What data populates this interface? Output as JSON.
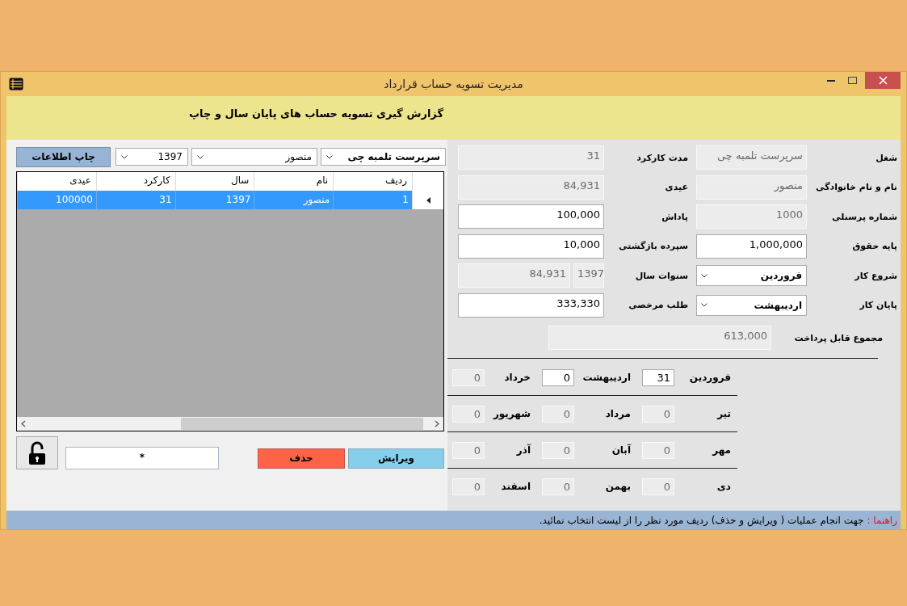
{
  "window": {
    "title": "مدیریت تسویه حساب قرارداد"
  },
  "header": {
    "text": "گزارش گیری تسویه حساب های پایان سال و چاپ"
  },
  "filters": {
    "print_button": "چاپ اطلاعات",
    "year": "1397",
    "name": "منصور",
    "job": "سرپرست تلمبه چی"
  },
  "table": {
    "columns": [
      "ردیف",
      "نام",
      "سال",
      "کارکرد",
      "عیدی"
    ],
    "rows": [
      {
        "selected": true,
        "cells": [
          "1",
          "منصور",
          "1397",
          "31",
          "100000"
        ]
      }
    ]
  },
  "actions": {
    "edit_button": "ویرایش",
    "delete_button": "حذف",
    "password": "*",
    "locked": false
  },
  "form": {
    "right": [
      {
        "label": "شغل",
        "kind": "text",
        "value": "سرپرست تلمبه چی",
        "disabled": true
      },
      {
        "label": "نام و نام خانوادگی",
        "kind": "text",
        "value": "منصور",
        "disabled": true
      },
      {
        "label": "شماره پرسنلی",
        "kind": "text",
        "value": "1000",
        "disabled": true
      },
      {
        "label": "پایه حقوق",
        "kind": "text",
        "value": "1,000,000",
        "disabled": false
      },
      {
        "label": "شروع کار",
        "kind": "select",
        "value": "فروردین",
        "disabled": false
      },
      {
        "label": "پایان کار",
        "kind": "select",
        "value": "اردیبهشت",
        "disabled": false
      }
    ],
    "left": [
      {
        "label": "مدت کارکرد",
        "kind": "text",
        "value": "31",
        "disabled": true
      },
      {
        "label": "عیدی",
        "kind": "text",
        "value": "84,931",
        "disabled": true
      },
      {
        "label": "پاداش",
        "kind": "text",
        "value": "100,000",
        "disabled": false
      },
      {
        "label": "سپرده بازگشتی",
        "kind": "text",
        "value": "10,000",
        "disabled": false
      },
      {
        "label": "سنوات سال",
        "kind": "pair",
        "value": "1397",
        "value_2": "84,931",
        "disabled": true
      },
      {
        "label": "طلب مرخصی",
        "kind": "text",
        "value": "333,330",
        "disabled": false
      }
    ],
    "total": {
      "label": "مجموع قابل پرداخت",
      "value": "613,000",
      "disabled": true
    }
  },
  "months": [
    {
      "label": "فروردین",
      "value": "31",
      "disabled": false
    },
    {
      "label": "اردیبهشت",
      "value": "0",
      "disabled": false
    },
    {
      "label": "خرداد",
      "value": "0",
      "disabled": true
    },
    {
      "label": "تیر",
      "value": "0",
      "disabled": true
    },
    {
      "label": "مرداد",
      "value": "0",
      "disabled": true
    },
    {
      "label": "شهریور",
      "value": "0",
      "disabled": true
    },
    {
      "label": "مهر",
      "value": "0",
      "disabled": true
    },
    {
      "label": "آبان",
      "value": "0",
      "disabled": true
    },
    {
      "label": "آذر",
      "value": "0",
      "disabled": true
    },
    {
      "label": "دی",
      "value": "0",
      "disabled": true
    },
    {
      "label": "بهمن",
      "value": "0",
      "disabled": true
    },
    {
      "label": "اسفند",
      "value": "0",
      "disabled": true
    }
  ],
  "status_bar": {
    "label": "راهنما :",
    "text": "جهت انجام عملیات ( ویرایش و حذف) ردیف مورد نظر را از لیست انتخاب نمائید."
  }
}
